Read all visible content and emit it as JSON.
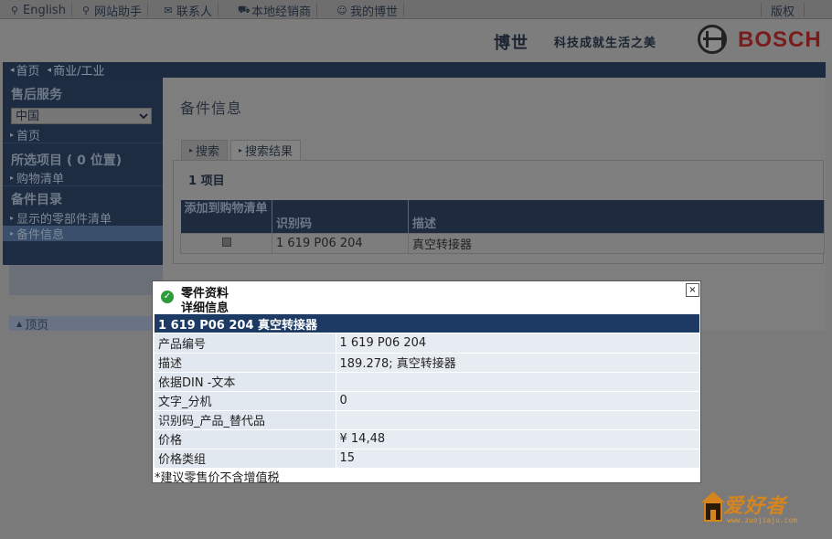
{
  "topbar": {
    "english": "English",
    "assistant": "网站助手",
    "contact": "联系人",
    "dealer": "本地经销商",
    "mybosch": "我的博世",
    "copyright": "版权"
  },
  "brand": {
    "name_cn": "博世",
    "slogan": "科技成就生活之美",
    "wordmark": "BOSCH",
    "brand_color": "#7a1c1c"
  },
  "breadcrumb": [
    "首页",
    "商业/工业"
  ],
  "sidebar": {
    "service_title": "售后服务",
    "country_selected": "中国",
    "home_link": "首页",
    "selected_title": "所选项目 ( 0 位置)",
    "shopping_list": "购物清单",
    "catalog_title": "备件目录",
    "show_parts_list": "显示的零部件清单",
    "parts_info": "备件信息",
    "top_link": "顶页"
  },
  "content": {
    "title": "备件信息",
    "tabs": [
      "搜索",
      "搜索结果"
    ],
    "result_count": "1 项目",
    "table_headers": [
      "添加到购物清单",
      "识别码",
      "描述"
    ],
    "rows": [
      {
        "cart_icon": "cart-icon",
        "id": "1 619 P06 204",
        "desc": "真空转接器"
      }
    ]
  },
  "modal": {
    "header_line1": "零件资料",
    "header_line2": "详细信息",
    "close_symbol": "×",
    "title_bar": "1 619 P06 204  真空转接器",
    "rows": [
      {
        "label": "产品编号",
        "value": "1 619 P06 204"
      },
      {
        "label": "描述",
        "value": "189.278; 真空转接器"
      },
      {
        "label": "依据DIN -文本",
        "value": ""
      },
      {
        "label": "文字_分机",
        "value": "0"
      },
      {
        "label": "识别码_产品_替代品",
        "value": ""
      },
      {
        "label": "价格",
        "value": "¥ 14,48"
      },
      {
        "label": "价格类组",
        "value": "15"
      }
    ],
    "note": "*建议零售价不含增值税",
    "accent_color": "#1c3a64"
  },
  "watermark": {
    "text": "爱好者",
    "url": "www.zuojiaju.com"
  }
}
